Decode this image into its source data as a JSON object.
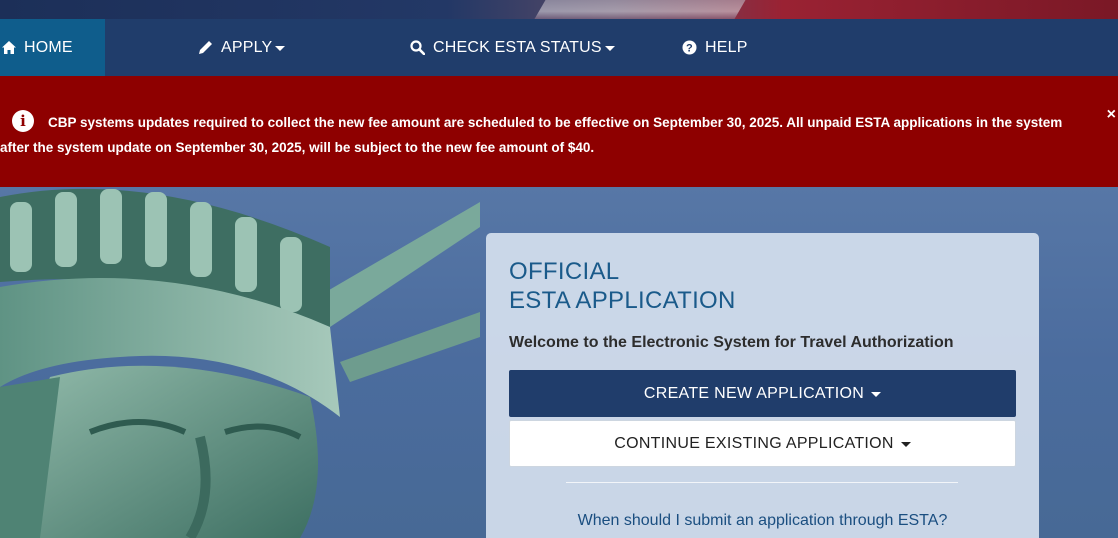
{
  "nav": {
    "home_label": "HOME",
    "apply_label": "APPLY",
    "status_label": "CHECK ESTA STATUS",
    "help_label": "HELP"
  },
  "alert": {
    "message": "CBP systems updates required to collect the new fee amount are scheduled to be effective on September 30, 2025. All unpaid ESTA applications in the system after the system update on September 30, 2025, will be subject to the new fee amount of $40.",
    "close_glyph": "×",
    "info_glyph": "i"
  },
  "card": {
    "title_line1": "OFFICIAL",
    "title_line2": "ESTA APPLICATION",
    "subtitle": "Welcome to the Electronic System for Travel Authorization",
    "create_label": "CREATE NEW APPLICATION",
    "continue_label": "CONTINUE EXISTING APPLICATION",
    "faq_link": "When should I submit an application through ESTA?"
  },
  "colors": {
    "nav_bg": "#203d6b",
    "home_active": "#0f5d8c",
    "alert_bg": "#8e0000",
    "card_title": "#1a5a8a"
  },
  "icons": {
    "home": "home-icon",
    "apply": "pencil-icon",
    "status": "search-icon",
    "help": "question-circle-icon",
    "alert": "info-circle-icon",
    "close": "close-icon"
  }
}
